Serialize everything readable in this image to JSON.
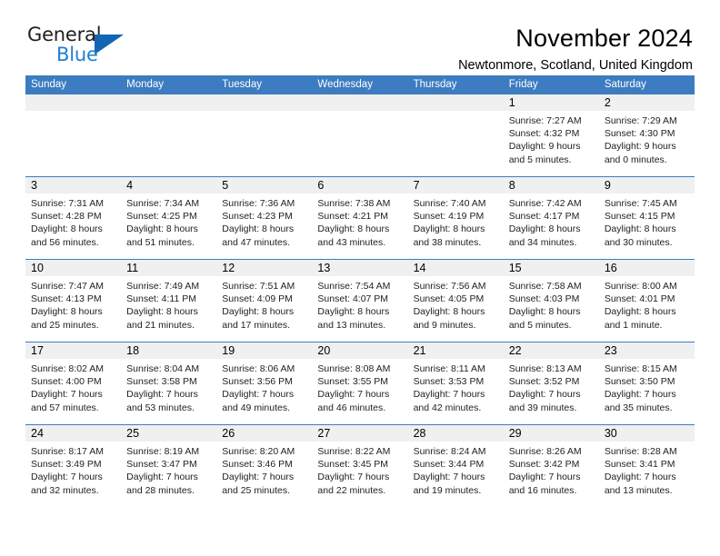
{
  "brand": {
    "name_part1": "General",
    "name_part2": "Blue",
    "accent_color": "#1266b2",
    "text_color": "#231f20"
  },
  "header": {
    "title": "November 2024",
    "location": "Newtonmore, Scotland, United Kingdom"
  },
  "calendar": {
    "header_color": "#3d7cc0",
    "date_band_color": "#f0f0f0",
    "weekdays": [
      "Sunday",
      "Monday",
      "Tuesday",
      "Wednesday",
      "Thursday",
      "Friday",
      "Saturday"
    ],
    "weeks": [
      {
        "days": [
          {
            "num": "",
            "lines": []
          },
          {
            "num": "",
            "lines": []
          },
          {
            "num": "",
            "lines": []
          },
          {
            "num": "",
            "lines": []
          },
          {
            "num": "",
            "lines": []
          },
          {
            "num": "1",
            "lines": [
              "Sunrise: 7:27 AM",
              "Sunset: 4:32 PM",
              "Daylight: 9 hours",
              "and 5 minutes."
            ]
          },
          {
            "num": "2",
            "lines": [
              "Sunrise: 7:29 AM",
              "Sunset: 4:30 PM",
              "Daylight: 9 hours",
              "and 0 minutes."
            ]
          }
        ]
      },
      {
        "days": [
          {
            "num": "3",
            "lines": [
              "Sunrise: 7:31 AM",
              "Sunset: 4:28 PM",
              "Daylight: 8 hours",
              "and 56 minutes."
            ]
          },
          {
            "num": "4",
            "lines": [
              "Sunrise: 7:34 AM",
              "Sunset: 4:25 PM",
              "Daylight: 8 hours",
              "and 51 minutes."
            ]
          },
          {
            "num": "5",
            "lines": [
              "Sunrise: 7:36 AM",
              "Sunset: 4:23 PM",
              "Daylight: 8 hours",
              "and 47 minutes."
            ]
          },
          {
            "num": "6",
            "lines": [
              "Sunrise: 7:38 AM",
              "Sunset: 4:21 PM",
              "Daylight: 8 hours",
              "and 43 minutes."
            ]
          },
          {
            "num": "7",
            "lines": [
              "Sunrise: 7:40 AM",
              "Sunset: 4:19 PM",
              "Daylight: 8 hours",
              "and 38 minutes."
            ]
          },
          {
            "num": "8",
            "lines": [
              "Sunrise: 7:42 AM",
              "Sunset: 4:17 PM",
              "Daylight: 8 hours",
              "and 34 minutes."
            ]
          },
          {
            "num": "9",
            "lines": [
              "Sunrise: 7:45 AM",
              "Sunset: 4:15 PM",
              "Daylight: 8 hours",
              "and 30 minutes."
            ]
          }
        ]
      },
      {
        "days": [
          {
            "num": "10",
            "lines": [
              "Sunrise: 7:47 AM",
              "Sunset: 4:13 PM",
              "Daylight: 8 hours",
              "and 25 minutes."
            ]
          },
          {
            "num": "11",
            "lines": [
              "Sunrise: 7:49 AM",
              "Sunset: 4:11 PM",
              "Daylight: 8 hours",
              "and 21 minutes."
            ]
          },
          {
            "num": "12",
            "lines": [
              "Sunrise: 7:51 AM",
              "Sunset: 4:09 PM",
              "Daylight: 8 hours",
              "and 17 minutes."
            ]
          },
          {
            "num": "13",
            "lines": [
              "Sunrise: 7:54 AM",
              "Sunset: 4:07 PM",
              "Daylight: 8 hours",
              "and 13 minutes."
            ]
          },
          {
            "num": "14",
            "lines": [
              "Sunrise: 7:56 AM",
              "Sunset: 4:05 PM",
              "Daylight: 8 hours",
              "and 9 minutes."
            ]
          },
          {
            "num": "15",
            "lines": [
              "Sunrise: 7:58 AM",
              "Sunset: 4:03 PM",
              "Daylight: 8 hours",
              "and 5 minutes."
            ]
          },
          {
            "num": "16",
            "lines": [
              "Sunrise: 8:00 AM",
              "Sunset: 4:01 PM",
              "Daylight: 8 hours",
              "and 1 minute."
            ]
          }
        ]
      },
      {
        "days": [
          {
            "num": "17",
            "lines": [
              "Sunrise: 8:02 AM",
              "Sunset: 4:00 PM",
              "Daylight: 7 hours",
              "and 57 minutes."
            ]
          },
          {
            "num": "18",
            "lines": [
              "Sunrise: 8:04 AM",
              "Sunset: 3:58 PM",
              "Daylight: 7 hours",
              "and 53 minutes."
            ]
          },
          {
            "num": "19",
            "lines": [
              "Sunrise: 8:06 AM",
              "Sunset: 3:56 PM",
              "Daylight: 7 hours",
              "and 49 minutes."
            ]
          },
          {
            "num": "20",
            "lines": [
              "Sunrise: 8:08 AM",
              "Sunset: 3:55 PM",
              "Daylight: 7 hours",
              "and 46 minutes."
            ]
          },
          {
            "num": "21",
            "lines": [
              "Sunrise: 8:11 AM",
              "Sunset: 3:53 PM",
              "Daylight: 7 hours",
              "and 42 minutes."
            ]
          },
          {
            "num": "22",
            "lines": [
              "Sunrise: 8:13 AM",
              "Sunset: 3:52 PM",
              "Daylight: 7 hours",
              "and 39 minutes."
            ]
          },
          {
            "num": "23",
            "lines": [
              "Sunrise: 8:15 AM",
              "Sunset: 3:50 PM",
              "Daylight: 7 hours",
              "and 35 minutes."
            ]
          }
        ]
      },
      {
        "days": [
          {
            "num": "24",
            "lines": [
              "Sunrise: 8:17 AM",
              "Sunset: 3:49 PM",
              "Daylight: 7 hours",
              "and 32 minutes."
            ]
          },
          {
            "num": "25",
            "lines": [
              "Sunrise: 8:19 AM",
              "Sunset: 3:47 PM",
              "Daylight: 7 hours",
              "and 28 minutes."
            ]
          },
          {
            "num": "26",
            "lines": [
              "Sunrise: 8:20 AM",
              "Sunset: 3:46 PM",
              "Daylight: 7 hours",
              "and 25 minutes."
            ]
          },
          {
            "num": "27",
            "lines": [
              "Sunrise: 8:22 AM",
              "Sunset: 3:45 PM",
              "Daylight: 7 hours",
              "and 22 minutes."
            ]
          },
          {
            "num": "28",
            "lines": [
              "Sunrise: 8:24 AM",
              "Sunset: 3:44 PM",
              "Daylight: 7 hours",
              "and 19 minutes."
            ]
          },
          {
            "num": "29",
            "lines": [
              "Sunrise: 8:26 AM",
              "Sunset: 3:42 PM",
              "Daylight: 7 hours",
              "and 16 minutes."
            ]
          },
          {
            "num": "30",
            "lines": [
              "Sunrise: 8:28 AM",
              "Sunset: 3:41 PM",
              "Daylight: 7 hours",
              "and 13 minutes."
            ]
          }
        ]
      }
    ]
  }
}
